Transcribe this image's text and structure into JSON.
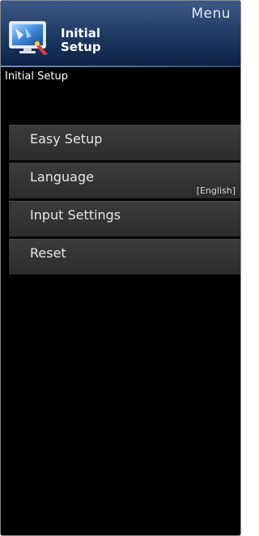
{
  "header": {
    "menu_label": "Menu",
    "title_line1": "Initial",
    "title_line2": "Setup",
    "icon": "initial-setup-icon"
  },
  "section_title": "Initial Setup",
  "menu_items": [
    {
      "label": "Easy Setup",
      "value": ""
    },
    {
      "label": "Language",
      "value": "[English]"
    },
    {
      "label": "Input Settings",
      "value": ""
    },
    {
      "label": "Reset",
      "value": ""
    }
  ],
  "colors": {
    "background": "#000000",
    "header": "#223e68",
    "menu_item": "#333333",
    "text": "#e6e6e6"
  }
}
